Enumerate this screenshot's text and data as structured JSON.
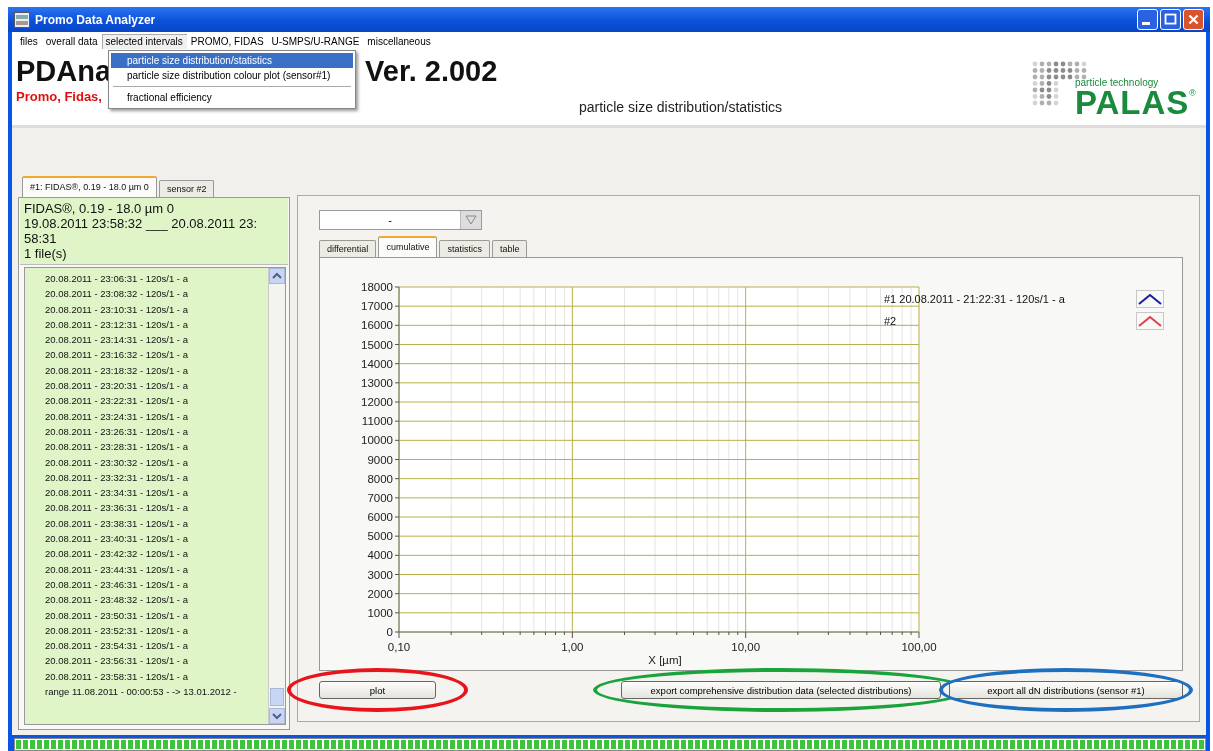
{
  "window": {
    "title": "Promo Data Analyzer"
  },
  "menu": [
    {
      "label": "files",
      "selected": false
    },
    {
      "label": "overall data",
      "selected": false
    },
    {
      "label": "selected intervals",
      "selected": true
    },
    {
      "label": "PROMO, FIDAS",
      "selected": false
    },
    {
      "label": "U-SMPS/U-RANGE",
      "selected": false
    },
    {
      "label": "miscellaneous",
      "selected": false
    }
  ],
  "open_menu": {
    "items": [
      {
        "label": "particle size distribution/statistics",
        "selected": true,
        "separator_after": false
      },
      {
        "label": "particle size distribution colour plot (sensor#1)",
        "selected": false,
        "separator_after": true
      },
      {
        "label": "fractional efficiency",
        "selected": false,
        "separator_after": false
      }
    ]
  },
  "header": {
    "app_name": "PDAna",
    "version": "Ver. 2.002",
    "subtitle": "Promo, Fidas,",
    "view_title": "particle size distribution/statistics",
    "logo": {
      "tagline": "particle technology",
      "brand": "PALAS",
      "mark": "®"
    }
  },
  "sensor_tabs": [
    {
      "label": "#1: FIDAS®, 0.19 - 18.0 µm 0",
      "selected": true
    },
    {
      "label": "sensor #2",
      "selected": false
    }
  ],
  "sensor_info": [
    "FIDAS®, 0.19 - 18.0 µm 0",
    "19.08.2011 23:58:32 ___ 20.08.2011 23:",
    "58:31",
    "1 file(s)"
  ],
  "files": [
    "20.08.2011 - 23:06:31 - 120s/1 -  a",
    "20.08.2011 - 23:08:32 - 120s/1 -  a",
    "20.08.2011 - 23:10:31 - 120s/1 -  a",
    "20.08.2011 - 23:12:31 - 120s/1 -  a",
    "20.08.2011 - 23:14:31 - 120s/1 -  a",
    "20.08.2011 - 23:16:32 - 120s/1 -  a",
    "20.08.2011 - 23:18:32 - 120s/1 -  a",
    "20.08.2011 - 23:20:31 - 120s/1 -  a",
    "20.08.2011 - 23:22:31 - 120s/1 -  a",
    "20.08.2011 - 23:24:31 - 120s/1 -  a",
    "20.08.2011 - 23:26:31 - 120s/1 -  a",
    "20.08.2011 - 23:28:31 - 120s/1 -  a",
    "20.08.2011 - 23:30:32 - 120s/1 -  a",
    "20.08.2011 - 23:32:31 - 120s/1 -  a",
    "20.08.2011 - 23:34:31 - 120s/1 -  a",
    "20.08.2011 - 23:36:31 - 120s/1 -  a",
    "20.08.2011 - 23:38:31 - 120s/1 -  a",
    "20.08.2011 - 23:40:31 - 120s/1 -  a",
    "20.08.2011 - 23:42:32 - 120s/1 -  a",
    "20.08.2011 - 23:44:31 - 120s/1 -  a",
    "20.08.2011 - 23:46:31 - 120s/1 -  a",
    "20.08.2011 - 23:48:32 - 120s/1 -  a",
    "20.08.2011 - 23:50:31 - 120s/1 -  a",
    "20.08.2011 - 23:52:31 - 120s/1 -  a",
    "20.08.2011 - 23:54:31 - 120s/1 -  a",
    "20.08.2011 - 23:56:31 - 120s/1 -  a",
    "20.08.2011 - 23:58:31 - 120s/1 -  a",
    "range 11.08.2011 - 00:00:53 - -> 13.01.2012 -"
  ],
  "selector": {
    "value": "-"
  },
  "view_tabs": [
    {
      "label": "differential",
      "selected": false
    },
    {
      "label": "cumulative",
      "selected": true
    },
    {
      "label": "statistics",
      "selected": false
    },
    {
      "label": "table",
      "selected": false
    }
  ],
  "chart_data": {
    "type": "line",
    "xlabel": "X [µm]",
    "categories": [
      "0,10",
      "1,00",
      "10,00",
      "100,00"
    ],
    "ylim": [
      0,
      18000
    ],
    "grid": true,
    "yticks": [
      0,
      1000,
      2000,
      3000,
      4000,
      5000,
      6000,
      7000,
      8000,
      9000,
      10000,
      11000,
      12000,
      13000,
      14000,
      15000,
      16000,
      17000,
      18000
    ],
    "series": [
      {
        "name": "#1 20.08.2011 - 21:22:31 - 120s/1 -  a",
        "color": "#1a1aa6",
        "values": [
          null,
          null,
          null,
          null
        ]
      },
      {
        "name": "#2",
        "color": "#e0404a",
        "values": [
          null,
          null,
          null,
          null
        ]
      }
    ]
  },
  "buttons": [
    {
      "label": "plot",
      "ring": {
        "color": "#e8141c"
      }
    },
    {
      "label": "export comprehensive distribution data (selected distributions)",
      "ring": {
        "color": "#19a33a"
      }
    },
    {
      "label": "export all dN distributions (sensor #1)",
      "ring": {
        "color": "#1d6fc0"
      }
    }
  ],
  "progress": {
    "level": 1
  }
}
